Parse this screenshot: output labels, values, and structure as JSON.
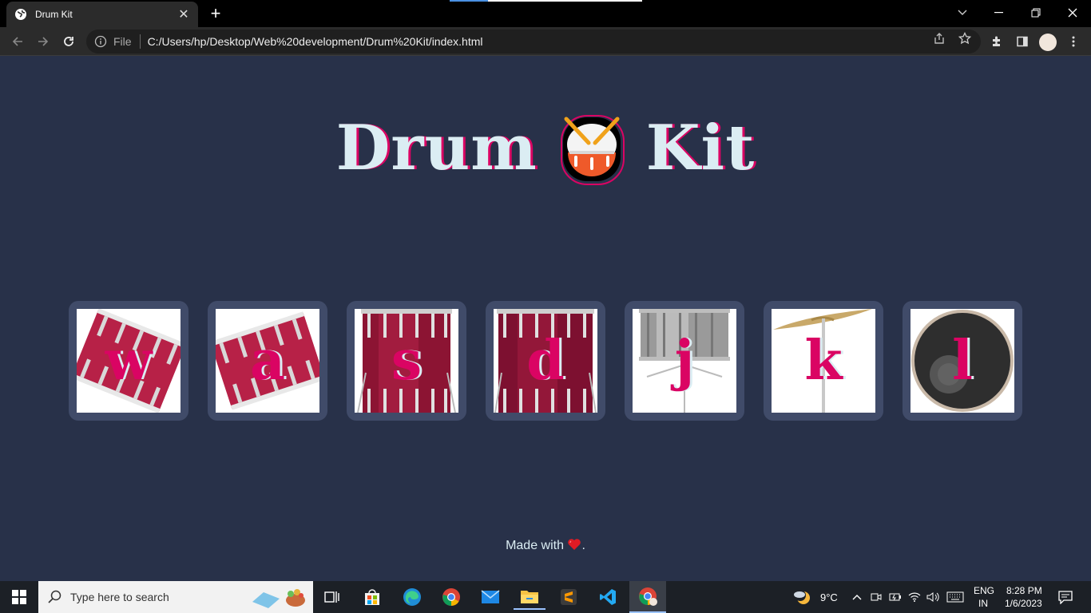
{
  "browser": {
    "tab_title": "Drum Kit",
    "address": {
      "scheme_label": "File",
      "url": "C:/Users/hp/Desktop/Web%20development/Drum%20Kit/index.html"
    }
  },
  "page": {
    "title_left": "Drum",
    "title_right": "Kit",
    "drums": [
      {
        "key": "w",
        "image": "tom-1"
      },
      {
        "key": "a",
        "image": "tom-2"
      },
      {
        "key": "s",
        "image": "tom-3"
      },
      {
        "key": "d",
        "image": "tom-4"
      },
      {
        "key": "j",
        "image": "snare"
      },
      {
        "key": "k",
        "image": "crash"
      },
      {
        "key": "l",
        "image": "kick"
      }
    ],
    "footer": {
      "text": "Made with",
      "suffix": "."
    }
  },
  "colors": {
    "background": "#283149",
    "button_frame": "#404b69",
    "accent": "#da0463",
    "light": "#dbedf3"
  },
  "taskbar": {
    "search_placeholder": "Type here to search",
    "weather": "9°C",
    "lang_top": "ENG",
    "lang_bottom": "IN",
    "time": "8:28 PM",
    "date": "1/6/2023"
  }
}
